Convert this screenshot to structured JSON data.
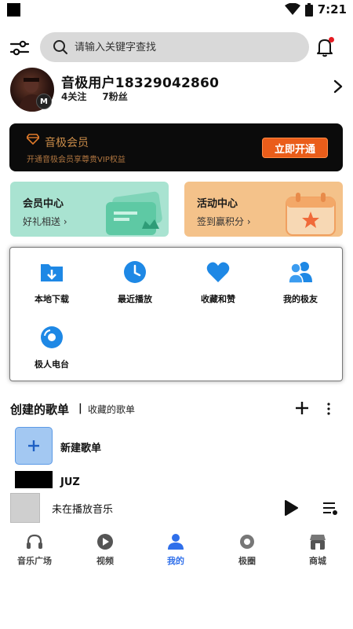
{
  "status_bar": {
    "time": "7:21"
  },
  "search": {
    "placeholder": "请输入关键字查找"
  },
  "profile": {
    "username": "音极用户18329042860",
    "following": "4关注",
    "followers": "7粉丝",
    "avatar_badge": "M"
  },
  "vip": {
    "title": "音极会员",
    "subtitle": "开通音极会员享尊贵VIP权益",
    "button": "立即开通"
  },
  "cards": {
    "member": {
      "title": "会员中心",
      "subtitle": "好礼相送 ›"
    },
    "event": {
      "title": "活动中心",
      "subtitle": "签到赢积分 ›"
    }
  },
  "shortcuts": [
    {
      "label": "本地下载",
      "icon": "folder-download-icon"
    },
    {
      "label": "最近播放",
      "icon": "clock-icon"
    },
    {
      "label": "收藏和赞",
      "icon": "heart-icon"
    },
    {
      "label": "我的极友",
      "icon": "friends-icon"
    },
    {
      "label": "极人电台",
      "icon": "radio-disc-icon"
    }
  ],
  "playlists": {
    "created_label": "创建的歌单",
    "separator": "|",
    "collected_label": "收藏的歌单",
    "items": [
      {
        "name": "新建歌单"
      },
      {
        "name": "JUZ"
      }
    ]
  },
  "player": {
    "status": "未在播放音乐"
  },
  "tabs": [
    {
      "label": "音乐广场",
      "icon": "headphones-icon"
    },
    {
      "label": "视频",
      "icon": "video-play-icon"
    },
    {
      "label": "我的",
      "icon": "user-icon",
      "active": true
    },
    {
      "label": "极圈",
      "icon": "circle-chat-icon"
    },
    {
      "label": "商城",
      "icon": "store-icon"
    }
  ],
  "colors": {
    "accent": "#2f6fea",
    "vip_gold": "#c98b48",
    "vip_button": "#ea5d1a",
    "member_card": "#a9e3d1",
    "event_card": "#f4c28a",
    "notification_dot": "#e51c23"
  }
}
